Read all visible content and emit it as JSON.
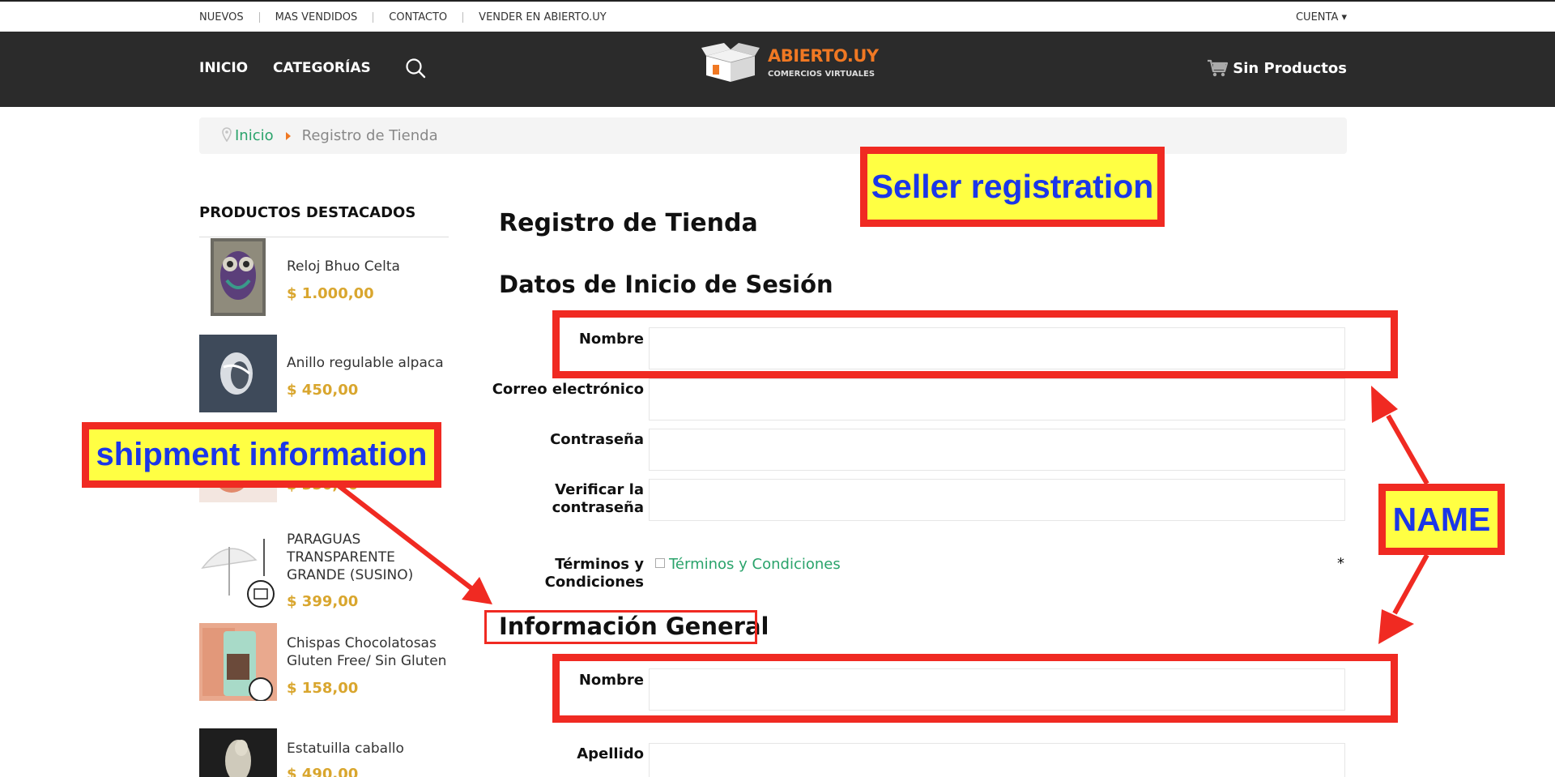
{
  "topbar": {
    "links": [
      "NUEVOS",
      "MAS VENDIDOS",
      "CONTACTO",
      "VENDER EN ABIERTO.UY"
    ],
    "account": "CUENTA ▾"
  },
  "nav": {
    "home": "INICIO",
    "categories": "CATEGORÍAS",
    "cart": "Sin Productos"
  },
  "logo": {
    "name": "ABIERTO.UY",
    "tagline": "COMERCIOS VIRTUALES"
  },
  "breadcrumb": {
    "home": "Inicio",
    "current": "Registro de Tienda"
  },
  "sidebar": {
    "title": "PRODUCTOS DESTACADOS",
    "products": [
      {
        "name": "Reloj Bhuo Celta",
        "price": "$ 1.000,00"
      },
      {
        "name": "Anillo regulable alpaca",
        "price": "$ 450,00"
      },
      {
        "name": "",
        "price": "$ 350,00"
      },
      {
        "name": "PARAGUAS TRANSPARENTE GRANDE (SUSINO)",
        "price": "$ 399,00"
      },
      {
        "name": "Chispas Chocolatosas Gluten Free/ Sin Gluten",
        "price": "$ 158,00"
      },
      {
        "name": "Estatuilla caballo",
        "price": "$ 490,00"
      }
    ]
  },
  "form": {
    "title": "Registro de Tienda",
    "login_section": "Datos de Inicio de Sesión",
    "name_label": "Nombre",
    "email_label": "Correo electrónico",
    "password_label": "Contraseña",
    "verify_label_1": "Verificar la",
    "verify_label_2": "contraseña",
    "terms_label_1": "Términos y",
    "terms_label_2": "Condiciones",
    "terms_link": "Términos y Condiciones",
    "terms_required": "*",
    "general_section": "Información General",
    "general_name_label": "Nombre",
    "lastname_label": "Apellido"
  },
  "annotations": {
    "seller": "Seller registration",
    "shipment": "shipment information",
    "name": "NAME"
  },
  "colors": {
    "nav_bg": "#2b2b2b",
    "accent_green": "#2aa36b",
    "price_gold": "#d9a62e",
    "logo_orange": "#f07823",
    "annotation_red": "#f02a22",
    "annotation_yellow": "#ffff43",
    "annotation_blue": "#1b36e8"
  }
}
